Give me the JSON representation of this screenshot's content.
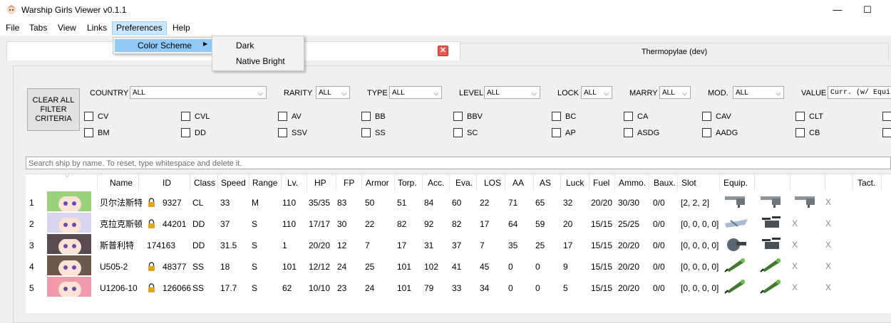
{
  "window": {
    "title": "Warship Girls Viewer v0.1.1",
    "minimize": "—",
    "maximize": "☐"
  },
  "menubar": {
    "items": [
      "File",
      "Tabs",
      "View",
      "Links",
      "Preferences",
      "Help"
    ],
    "active": "Preferences"
  },
  "menu_preferences": {
    "items": [
      {
        "label": "Color Scheme",
        "submenu_arrow": "▶"
      }
    ]
  },
  "submenu_color_scheme": {
    "items": [
      "Dark",
      "Native Bright"
    ]
  },
  "tabs": [
    {
      "label": "",
      "close": "✕"
    },
    {
      "label": "Thermopylae (dev)"
    }
  ],
  "filters": {
    "clear_button": "CLEAR ALL FILTER CRITERIA",
    "country": {
      "label": "COUNTRY",
      "value": "ALL"
    },
    "rarity": {
      "label": "RARITY",
      "value": "ALL"
    },
    "type": {
      "label": "TYPE",
      "value": "ALL"
    },
    "level": {
      "label": "LEVEL",
      "value": "ALL"
    },
    "lock": {
      "label": "LOCK",
      "value": "ALL"
    },
    "marry": {
      "label": "MARRY",
      "value": "ALL"
    },
    "mod": {
      "label": "MOD.",
      "value": "ALL"
    },
    "value": {
      "label": "VALUE",
      "value": "Curr. (w/ Equi"
    },
    "type_checkboxes_row1": [
      "CV",
      "CVL",
      "AV",
      "BB",
      "BBV",
      "BC",
      "CA",
      "CAV",
      "CLT"
    ],
    "type_checkboxes_row2": [
      "BM",
      "DD",
      "SSV",
      "SS",
      "SC",
      "AP",
      "ASDG",
      "AADG",
      "CB"
    ]
  },
  "search": {
    "placeholder": "Search ship by name. To reset, type whitespace and delete it."
  },
  "table": {
    "headers": [
      "Name",
      "ID",
      "Class",
      "Speed",
      "Range",
      "Lv.",
      "HP",
      "FP",
      "Armor",
      "Torp.",
      "Acc.",
      "Eva.",
      "LOS",
      "AA",
      "AS",
      "Luck",
      "Fuel",
      "Ammo.",
      "Baux.",
      "Slot",
      "Equip.",
      "Tact."
    ],
    "rows": [
      {
        "num": "1",
        "name": "贝尔法斯特",
        "locked": true,
        "id": "9327",
        "class": "CL",
        "speed": "33",
        "range": "M",
        "lv": "110",
        "hp": "35/35",
        "fp": "83",
        "armor": "50",
        "torp": "51",
        "acc": "84",
        "eva": "60",
        "los": "22",
        "aa": "71",
        "as": "65",
        "luck": "32",
        "fuel": "20/20",
        "ammo": "30/30",
        "baux": "0/0",
        "slot": "[2, 2, 2]",
        "equip": [
          "gun-icon",
          "gun-icon",
          "gun-icon",
          "X"
        ],
        "portrait_hair": "#9ad17a"
      },
      {
        "num": "2",
        "name": "克拉克斯顿",
        "locked": true,
        "id": "44201",
        "class": "DD",
        "speed": "37",
        "range": "S",
        "lv": "110",
        "hp": "17/17",
        "fp": "30",
        "armor": "22",
        "torp": "82",
        "acc": "92",
        "eva": "82",
        "los": "17",
        "aa": "64",
        "as": "59",
        "luck": "20",
        "fuel": "15/15",
        "ammo": "25/25",
        "baux": "0/0",
        "slot": "[0, 0, 0, 0]",
        "equip": [
          "plane-icon",
          "turret-icon",
          "X",
          "X"
        ],
        "portrait_hair": "#d9d4ef"
      },
      {
        "num": "3",
        "name": "斯普利特",
        "locked": false,
        "id": "174163",
        "class": "DD",
        "speed": "31.5",
        "range": "S",
        "lv": "1",
        "hp": "20/20",
        "fp": "12",
        "armor": "7",
        "torp": "17",
        "acc": "31",
        "eva": "37",
        "los": "7",
        "aa": "35",
        "as": "25",
        "luck": "17",
        "fuel": "15/15",
        "ammo": "20/20",
        "baux": "0/0",
        "slot": "[0, 0, 0, 0]",
        "equip": [
          "cannon-icon",
          "turret-icon",
          "X",
          "X"
        ],
        "portrait_hair": "#5a4a52"
      },
      {
        "num": "4",
        "name": "U505-2",
        "locked": true,
        "id": "48377",
        "class": "SS",
        "speed": "18",
        "range": "S",
        "lv": "101",
        "hp": "12/12",
        "fp": "24",
        "armor": "25",
        "torp": "101",
        "acc": "102",
        "eva": "41",
        "los": "45",
        "aa": "0",
        "as": "0",
        "luck": "9",
        "fuel": "15/15",
        "ammo": "20/20",
        "baux": "0/0",
        "slot": "[0, 0, 0, 0]",
        "equip": [
          "torpedo-icon",
          "torpedo-icon",
          "X",
          "X"
        ],
        "portrait_hair": "#6b5a4c"
      },
      {
        "num": "5",
        "name": "U1206-10",
        "locked": true,
        "id": "126066",
        "class": "SS",
        "speed": "17.7",
        "range": "S",
        "lv": "62",
        "hp": "10/10",
        "fp": "23",
        "armor": "24",
        "torp": "101",
        "acc": "79",
        "eva": "33",
        "los": "34",
        "aa": "0",
        "as": "0",
        "luck": "5",
        "fuel": "15/15",
        "ammo": "20/20",
        "baux": "0/0",
        "slot": "[0, 0, 0, 0]",
        "equip": [
          "torpedo-icon",
          "torpedo-icon",
          "X",
          "X"
        ],
        "portrait_hair": "#f19aab"
      }
    ]
  },
  "colors": {
    "menu_highlight": "#cce8ff",
    "submenu_highlight": "#91c9f7",
    "close_red": "#e8574a",
    "lock_gold": "#e2a51a"
  }
}
